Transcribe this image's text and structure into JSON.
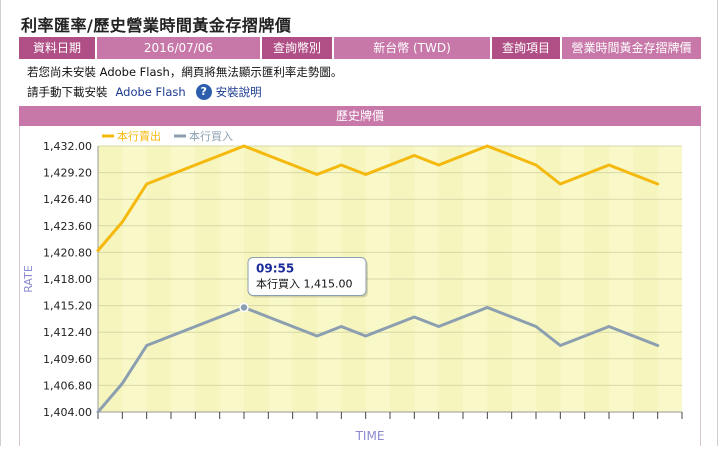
{
  "page": {
    "title": "利率匯率/歷史營業時間黃金存摺牌價"
  },
  "info_bar": [
    {
      "label": "資料日期"
    },
    {
      "label": "2016/07/06"
    },
    {
      "label": "查詢幣別"
    },
    {
      "label": "新台幣 (TWD)"
    },
    {
      "label": "查詢項目"
    },
    {
      "label": "營業時間黃金存摺牌價"
    }
  ],
  "notes": {
    "flash_notice": "若您尚未安裝 Adobe Flash，網頁將無法顯示匯利率走勢圖。",
    "download_prefix": "請手動下載安裝",
    "download_link": "Adobe Flash",
    "help_icon_glyph": "?",
    "help_link": "安裝說明"
  },
  "section_title": "歷史牌價",
  "colors": {
    "brand_purple": "#b04f86",
    "sell_line": "#f5b90e",
    "buy_line": "#8c9fb0",
    "plot_bg": "#f8f8c8"
  },
  "chart_data": {
    "type": "line",
    "xlabel": "TIME",
    "ylabel": "RATE",
    "ylim": [
      1404.0,
      1432.0
    ],
    "yticks": [
      "1,404.00",
      "1,406.80",
      "1,409.60",
      "1,412.40",
      "1,415.20",
      "1,418.00",
      "1,420.80",
      "1,423.60",
      "1,426.40",
      "1,429.20",
      "1,432.00"
    ],
    "grid": true,
    "legend_position": "top-left",
    "x_count": 25,
    "series": [
      {
        "name": "本行賣出",
        "color": "#f5b90e",
        "values": [
          1421.0,
          1424.0,
          1428.0,
          1429.0,
          1430.0,
          1431.0,
          1432.0,
          1431.0,
          1430.0,
          1429.0,
          1430.0,
          1429.0,
          1430.0,
          1431.0,
          1430.0,
          1431.0,
          1432.0,
          1431.0,
          1430.0,
          1428.0,
          1429.0,
          1430.0,
          1429.0,
          1428.0
        ]
      },
      {
        "name": "本行買入",
        "color": "#8c9fb0",
        "values": [
          1404.0,
          1407.0,
          1411.0,
          1412.0,
          1413.0,
          1414.0,
          1415.0,
          1414.0,
          1413.0,
          1412.0,
          1413.0,
          1412.0,
          1413.0,
          1414.0,
          1413.0,
          1414.0,
          1415.0,
          1414.0,
          1413.0,
          1411.0,
          1412.0,
          1413.0,
          1412.0,
          1411.0
        ]
      }
    ],
    "tooltip": {
      "time": "09:55",
      "text": "本行買入 1,415.00",
      "series_index": 1,
      "point_index": 6
    }
  }
}
